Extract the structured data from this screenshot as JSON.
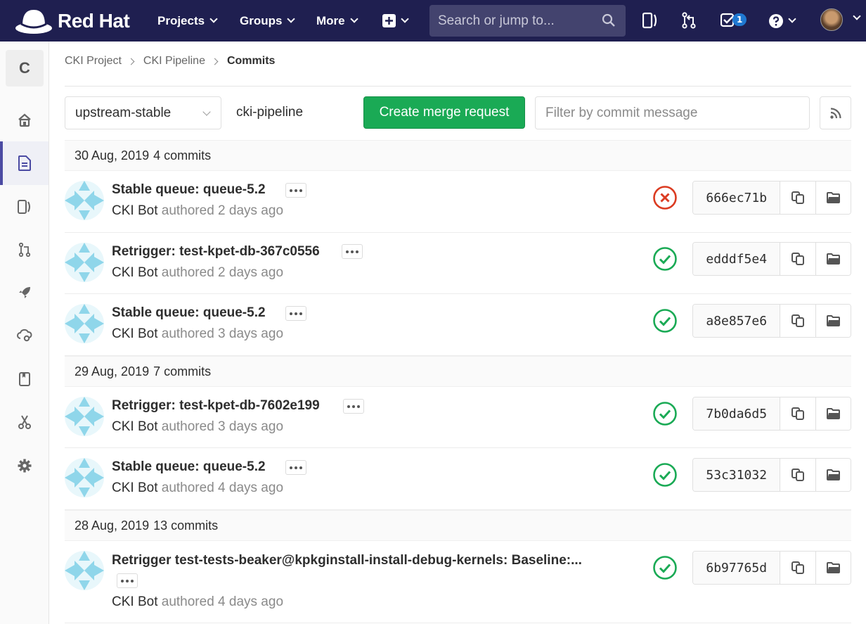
{
  "topbar": {
    "brand": "Red Hat",
    "nav": [
      {
        "label": "Projects"
      },
      {
        "label": "Groups"
      },
      {
        "label": "More"
      }
    ],
    "search_placeholder": "Search or jump to...",
    "todo_count": "1",
    "icons": [
      "plus-square-icon",
      "issues-icon",
      "merge-request-icon",
      "todo-icon",
      "help-icon",
      "user-avatar"
    ]
  },
  "sidebar": {
    "project_letter": "C",
    "items": [
      "project-home-icon",
      "repository-icon",
      "issues-icon",
      "merge-requests-icon",
      "ci-cd-icon",
      "operations-icon",
      "wiki-icon",
      "snippets-icon",
      "settings-icon"
    ],
    "active_index": 1
  },
  "breadcrumb": [
    "CKI Project",
    "CKI Pipeline",
    "Commits"
  ],
  "controls": {
    "branch": "upstream-stable",
    "repo": "cki-pipeline",
    "create_mr_label": "Create merge request",
    "filter_placeholder": "Filter by commit message"
  },
  "days": [
    {
      "date": "30 Aug, 2019",
      "count": "4 commits",
      "commits": [
        {
          "title": "Stable queue: queue-5.2",
          "author": "CKI Bot",
          "time": "authored 2 days ago",
          "status": "failed",
          "sha": "666ec71b"
        },
        {
          "title": "Retrigger: test-kpet-db-367c0556",
          "author": "CKI Bot",
          "time": "authored 2 days ago",
          "status": "passed",
          "sha": "edddf5e4"
        },
        {
          "title": "Stable queue: queue-5.2",
          "author": "CKI Bot",
          "time": "authored 3 days ago",
          "status": "passed",
          "sha": "a8e857e6"
        }
      ]
    },
    {
      "date": "29 Aug, 2019",
      "count": "7 commits",
      "commits": [
        {
          "title": "Retrigger: test-kpet-db-7602e199",
          "author": "CKI Bot",
          "time": "authored 3 days ago",
          "status": "passed",
          "sha": "7b0da6d5"
        },
        {
          "title": "Stable queue: queue-5.2",
          "author": "CKI Bot",
          "time": "authored 4 days ago",
          "status": "passed",
          "sha": "53c31032"
        }
      ]
    },
    {
      "date": "28 Aug, 2019",
      "count": "13 commits",
      "commits": [
        {
          "title": "Retrigger test-tests-beaker@kpkginstall-install-debug-kernels: Baseline:...",
          "author": "CKI Bot",
          "time": "authored 4 days ago",
          "status": "passed",
          "sha": "6b97765d"
        }
      ]
    }
  ],
  "colors": {
    "navbar": "#1f1f50",
    "success": "#1aaa55",
    "failed": "#db3b21",
    "accent": "#4b4ba3"
  }
}
